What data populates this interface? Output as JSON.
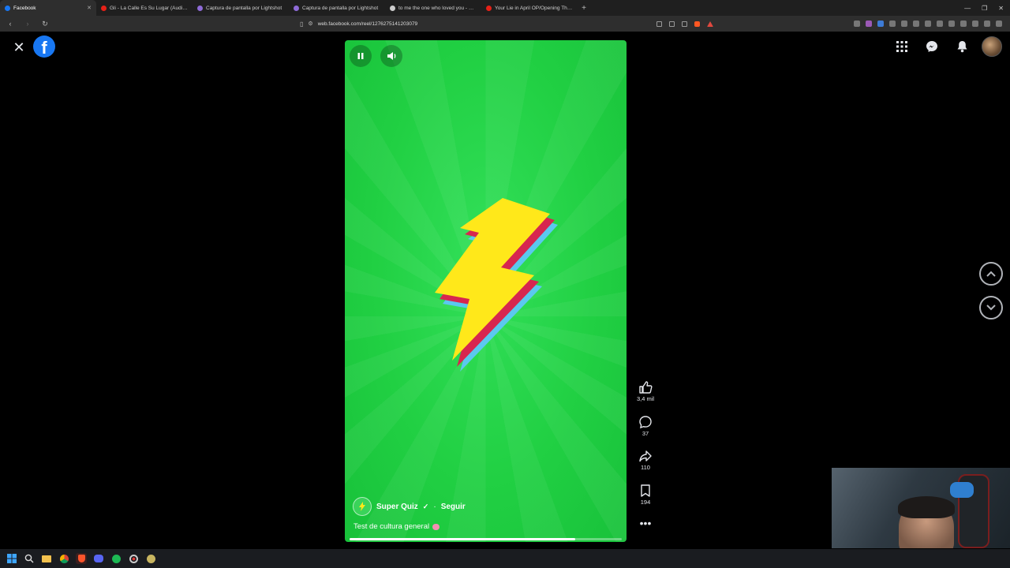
{
  "browser": {
    "tabs": [
      {
        "title": "Facebook",
        "active": true,
        "icon_color": "#1877f2"
      },
      {
        "title": "Gli - La Calle Es Su Lugar (Audio) - Yo",
        "icon_color": "#e62117"
      },
      {
        "title": "Captura de pantalla por Lightshot",
        "icon_color": "#8e6bd8"
      },
      {
        "title": "Captura de pantalla por Lightshot",
        "icon_color": "#8e6bd8"
      },
      {
        "title": "to me the one who loved you - Bus",
        "icon_color": "#cccccc"
      },
      {
        "title": "Your Lie in April OP/Opening Theme",
        "icon_color": "#e62117"
      }
    ],
    "url": "web.facebook.com/reel/1276275141203079"
  },
  "reel": {
    "author": "Super Quiz",
    "follow_label": "Seguir",
    "separator": "·",
    "caption": "Test de cultura general",
    "progress_fraction": 0.83
  },
  "actions": {
    "likes": "3,4 mil",
    "comments": "37",
    "shares": "110",
    "saves": "194"
  },
  "colors": {
    "facebook_blue": "#1877f2",
    "reel_green": "#21d043"
  }
}
